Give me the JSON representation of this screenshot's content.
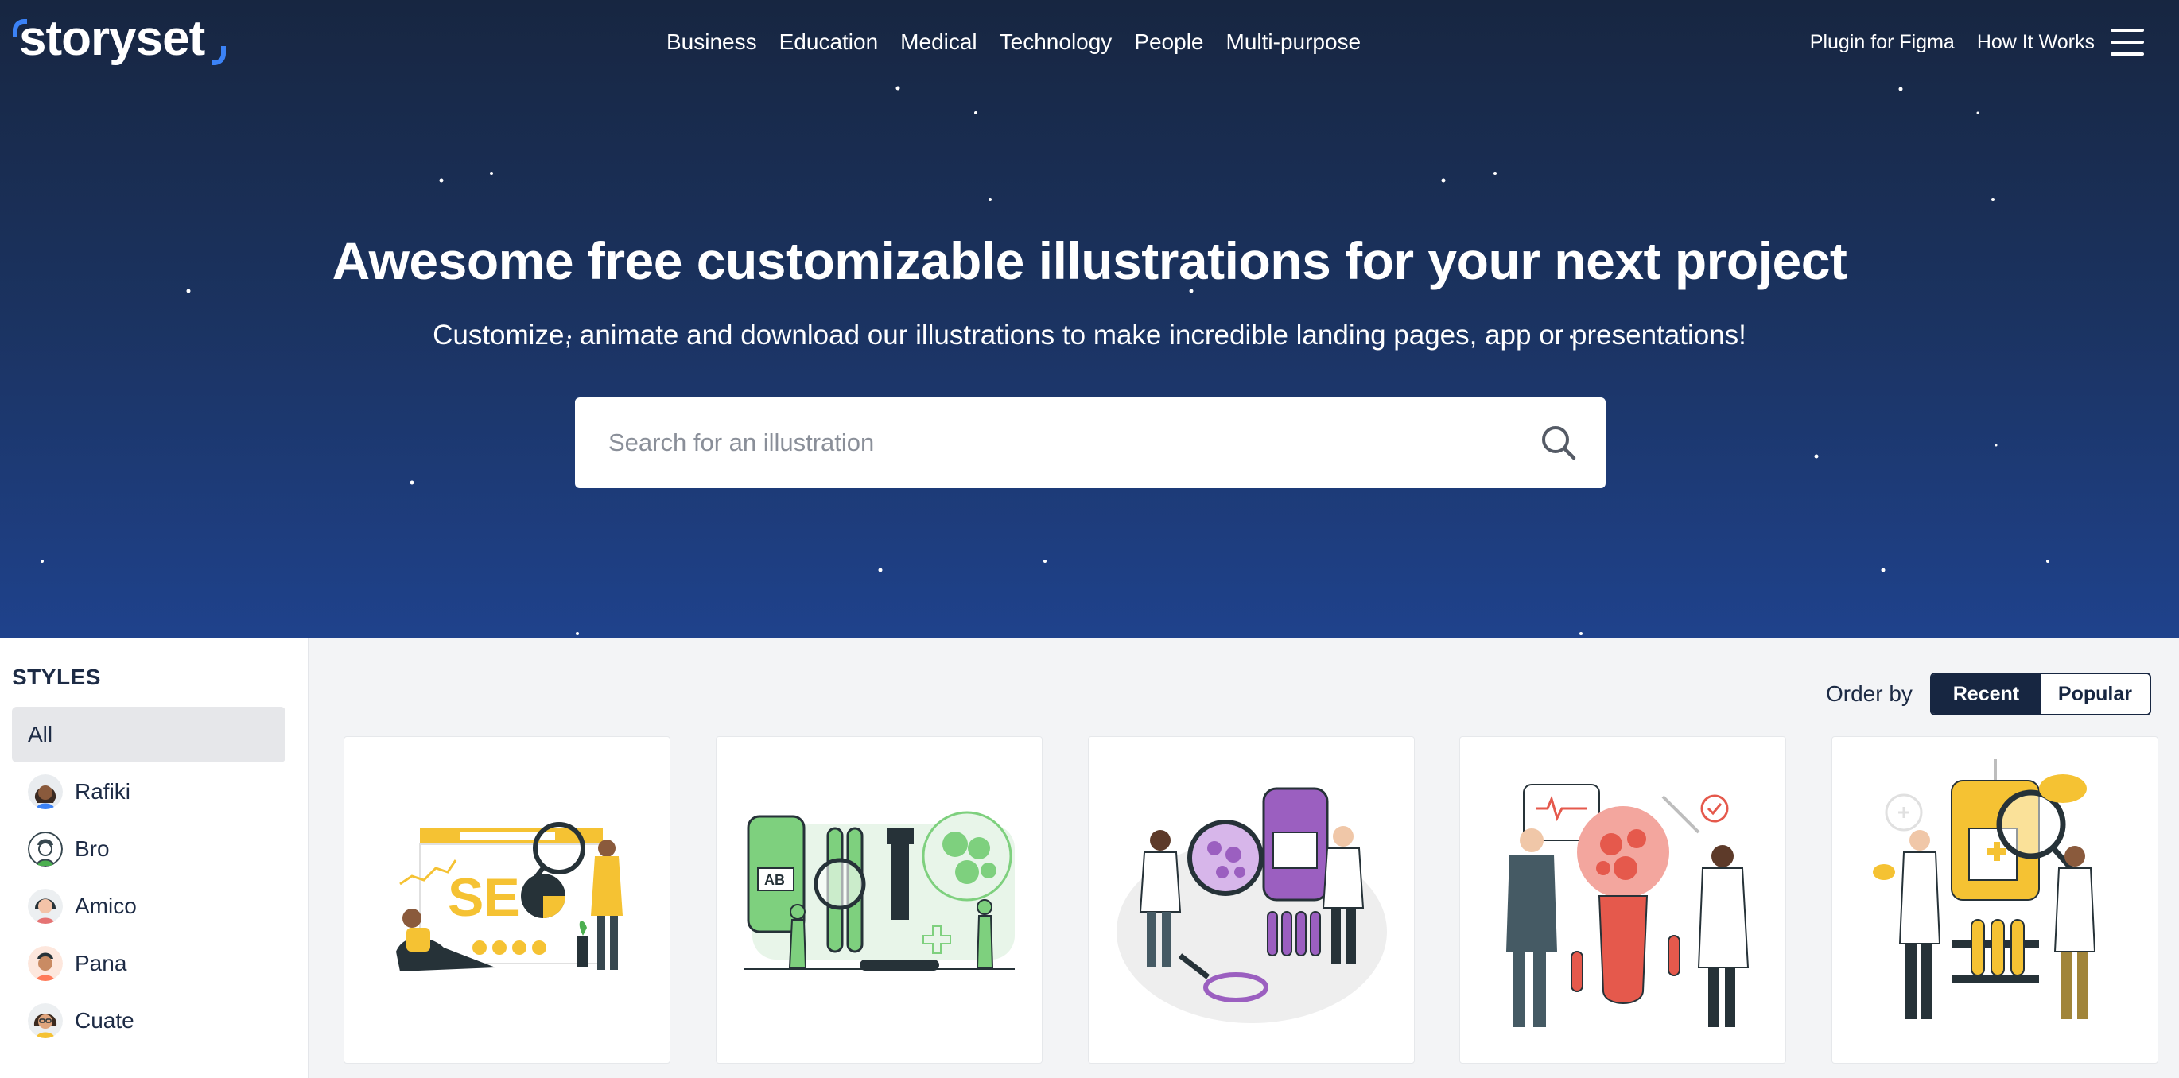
{
  "brand": {
    "logo_text": "storyset"
  },
  "nav": {
    "categories": [
      "Business",
      "Education",
      "Medical",
      "Technology",
      "People",
      "Multi-purpose"
    ],
    "plugin_link": "Plugin for Figma",
    "how_link": "How It Works"
  },
  "hero": {
    "headline": "Awesome free customizable illustrations for your next project",
    "subline": "Customize, animate and download our illustrations to make incredible landing pages, app or presentations!"
  },
  "search": {
    "placeholder": "Search for an illustration"
  },
  "sidebar": {
    "title": "STYLES",
    "items": [
      {
        "label": "All",
        "active": true
      },
      {
        "label": "Rafiki",
        "avatar": "rafiki-avatar"
      },
      {
        "label": "Bro",
        "avatar": "bro-avatar"
      },
      {
        "label": "Amico",
        "avatar": "amico-avatar"
      },
      {
        "label": "Pana",
        "avatar": "pana-avatar"
      },
      {
        "label": "Cuate",
        "avatar": "cuate-avatar"
      }
    ]
  },
  "order": {
    "label": "Order by",
    "options": [
      "Recent",
      "Popular"
    ],
    "selected": "Recent"
  },
  "cards": [
    {
      "illustration": "seo-analysis-illustration",
      "accent": "#f5c233"
    },
    {
      "illustration": "blood-lab-research-illustration",
      "accent": "#7ed07e"
    },
    {
      "illustration": "cell-research-illustration",
      "accent": "#9b5fc0"
    },
    {
      "illustration": "blood-cells-research-illustration",
      "accent": "#e5594c"
    },
    {
      "illustration": "blood-donation-analysis-illustration",
      "accent": "#f5c233"
    }
  ],
  "colors": {
    "hero_top": "#172641",
    "hero_bottom": "#1f428c",
    "accent_blue": "#3b82f6"
  }
}
